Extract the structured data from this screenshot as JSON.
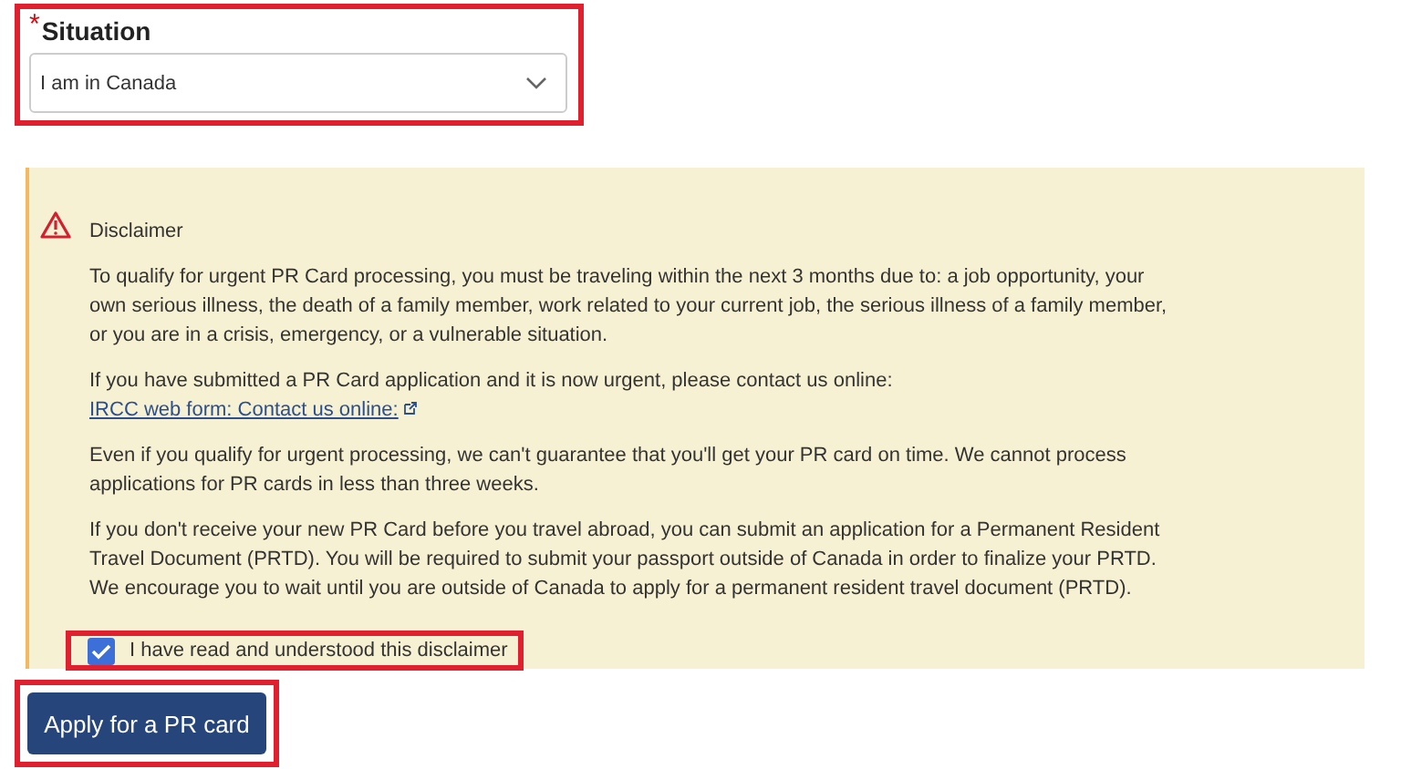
{
  "situation": {
    "required_mark": "*",
    "label": "Situation",
    "value": "I am in Canada"
  },
  "disclaimer": {
    "title": "Disclaimer",
    "paragraphs": [
      {
        "text": "To qualify for urgent PR Card processing, you must be traveling within the next 3 months due to: a job opportunity, your own serious illness, the death of a family member, work related to your current job, the serious illness of a family member, or you are in a crisis, emergency, or a vulnerable situation."
      },
      {
        "text": "If you have submitted a PR Card application and it is now urgent, please contact us online: ",
        "link": "IRCC web form: Contact us online:"
      },
      {
        "text": "Even if you qualify for urgent processing, we can't guarantee that you'll get your PR card on time. We cannot process applications for PR cards in less than three weeks."
      },
      {
        "text": "If you don't receive your new PR Card before you travel abroad, you can submit an application for a Permanent Resident Travel Document (PRTD). You will be required to submit your passport outside of Canada in order to finalize your PRTD. We encourage you to wait until you are outside of Canada to apply for a permanent resident travel document (PRTD)."
      }
    ],
    "agreement": {
      "label": "I have read and understood this disclaimer",
      "checked": true
    }
  },
  "apply_button": "Apply for a PR card"
}
